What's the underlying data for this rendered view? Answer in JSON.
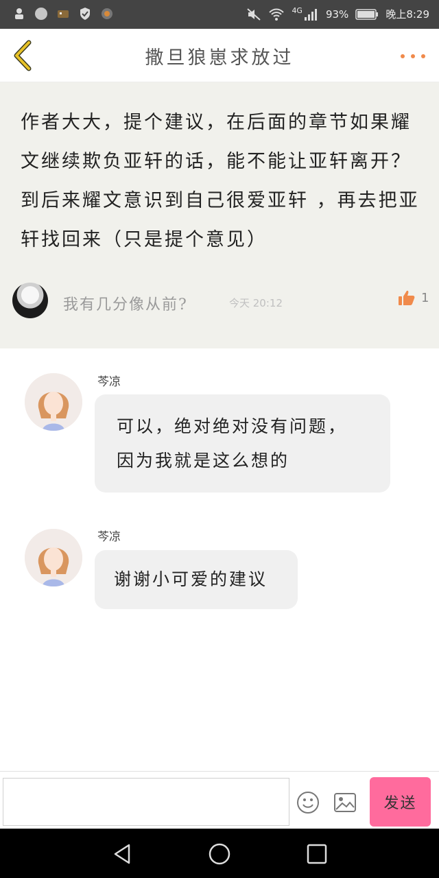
{
  "status_bar": {
    "signal_label": "4G",
    "battery_percent": "93%",
    "time": "晚上8:29",
    "left_icons": [
      "notification-icon",
      "pinwheel-icon",
      "game-icon",
      "shield-icon",
      "camera-icon"
    ],
    "right_icons": [
      "mute-icon",
      "wifi-icon",
      "signal-icon",
      "battery-icon"
    ]
  },
  "header": {
    "title": "撒旦狼崽求放过",
    "accent_color": "#f08a4b",
    "back_icon": "chevron-left-icon",
    "more_icon": "more-dots-icon"
  },
  "comment": {
    "text_lines": [
      "作者大大，提个建议，在后面的章节如果耀",
      "文继续欺负亚轩的话，能不能让亚轩离开？",
      "到后来耀文意识到自己很爱亚轩 ，再去把亚",
      "轩找回来（只是提个意见）"
    ],
    "author": "我有几分像从前?",
    "time": "今天 20:12",
    "likes": "1",
    "like_icon": "thumbs-up-icon",
    "like_color": "#f08a4b"
  },
  "replies": [
    {
      "name": "芩凉",
      "lines": [
        "可以，绝对绝对没有问题，",
        "因为我就是这么想的"
      ]
    },
    {
      "name": "芩凉",
      "lines": [
        "谢谢小可爱的建议"
      ]
    }
  ],
  "input_bar": {
    "placeholder": "",
    "send_label": "发送",
    "send_color": "#ff6b9d",
    "emoji_icon": "smiley-icon",
    "image_icon": "image-icon"
  },
  "nav_bar": {
    "icons": [
      "back-triangle-icon",
      "home-circle-icon",
      "recents-square-icon"
    ]
  }
}
